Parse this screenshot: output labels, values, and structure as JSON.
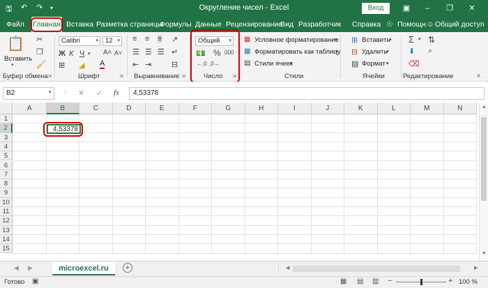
{
  "titlebar": {
    "title": "Округление чисел  -  Excel",
    "login_label": "Вход",
    "restore_icon": "restore-icon",
    "minimize_icon": "minimize-icon",
    "close_icon": "close-icon"
  },
  "tabs": {
    "items": [
      "Файл",
      "Главная",
      "Вставка",
      "Разметка страницы",
      "Формулы",
      "Данные",
      "Рецензирование",
      "Вид",
      "Разработчик",
      "Справка"
    ],
    "help_label": "Помощн",
    "share_label": "Общий доступ"
  },
  "ribbon": {
    "clipboard": {
      "paste_label": "Вставить",
      "group_label": "Буфер обмена"
    },
    "font": {
      "font_name": "Calibri",
      "font_size": "12",
      "group_label": "Шрифт"
    },
    "alignment": {
      "group_label": "Выравнивание"
    },
    "number": {
      "format_value": "Общий",
      "group_label": "Число"
    },
    "styles": {
      "conditional_label": "Условное форматирование",
      "table_label": "Форматировать как таблицу",
      "cell_styles_label": "Стили ячеек",
      "group_label": "Стили"
    },
    "cells": {
      "insert_label": "Вставить",
      "delete_label": "Удалить",
      "format_label": "Формат",
      "group_label": "Ячейки"
    },
    "editing": {
      "group_label": "Редактирование"
    }
  },
  "formula_bar": {
    "name_box": "B2",
    "value": "4,53378",
    "fx_label": "fx"
  },
  "grid": {
    "columns": [
      "A",
      "B",
      "C",
      "D",
      "E",
      "F",
      "G",
      "H",
      "I",
      "J",
      "K",
      "L",
      "M",
      "N"
    ],
    "rows": [
      "1",
      "2",
      "3",
      "4",
      "5",
      "6",
      "7",
      "8",
      "9",
      "10",
      "11",
      "12",
      "13",
      "14",
      "15"
    ],
    "cell_B2": "4,53378"
  },
  "sheets": {
    "active": "microexcel.ru"
  },
  "status": {
    "ready": "Готово",
    "zoom": "100 %"
  }
}
